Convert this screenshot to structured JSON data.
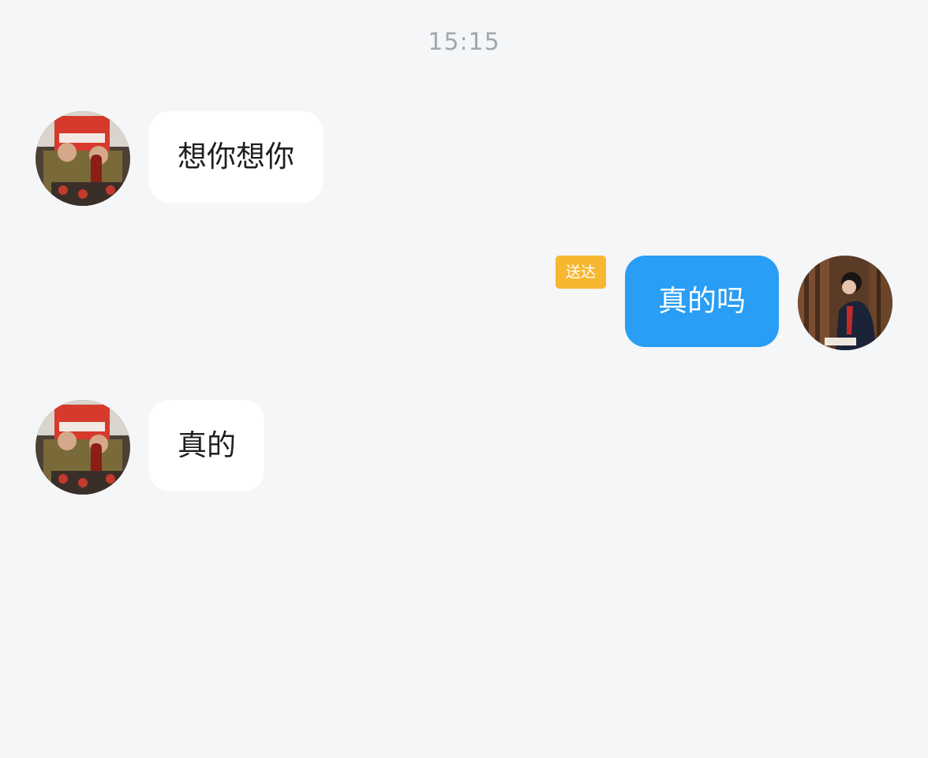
{
  "chat": {
    "timestamp": "15:15",
    "messages": [
      {
        "direction": "incoming",
        "text": "想你想你",
        "avatar": "contact-avatar"
      },
      {
        "direction": "outgoing",
        "text": "真的吗",
        "status": "送达",
        "avatar": "user-avatar"
      },
      {
        "direction": "incoming",
        "text": "真的",
        "avatar": "contact-avatar"
      }
    ]
  },
  "colors": {
    "background": "#f5f6f8",
    "incoming_bubble": "#ffffff",
    "outgoing_bubble": "#2a9df4",
    "status_tag": "#f7b731",
    "timestamp_text": "#a3a7ad"
  }
}
